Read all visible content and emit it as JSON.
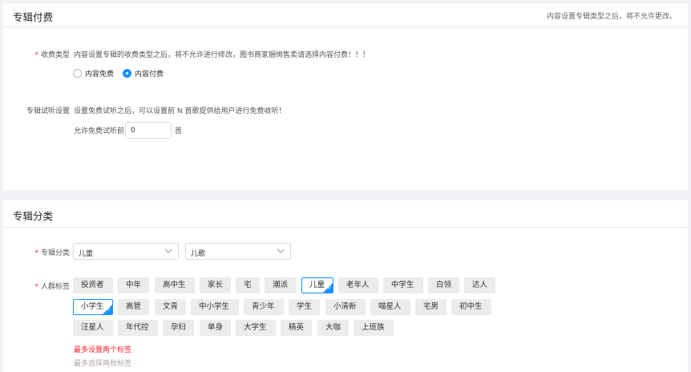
{
  "section1": {
    "title": "专辑付费",
    "note": "内容设置专辑类型之后，将不允许更改。",
    "fee_type": {
      "label": "收费类型",
      "required_mark": "*",
      "description": "内容设置专辑的收费类型之后，将不允许进行修改，图书商家捆绑售卖请选择内容付费！！！",
      "options": [
        {
          "label": "内容免费",
          "checked": false
        },
        {
          "label": "内容付费",
          "checked": true
        }
      ]
    },
    "trial": {
      "label": "专辑试听设置",
      "description": "设置免费试听之后，可以设置前 N 首歌提供给用户进行免费收听！",
      "prefix": "允许免费试听前",
      "value": "0",
      "suffix": "首"
    }
  },
  "section2": {
    "title": "专辑分类",
    "category": {
      "label": "专辑分类",
      "required_mark": "*",
      "primary": "儿童",
      "secondary": "儿歌"
    },
    "audience": {
      "label": "人群标签",
      "required_mark": "*",
      "tags_row1": [
        {
          "label": "投资者",
          "selected": false
        },
        {
          "label": "中年",
          "selected": false
        },
        {
          "label": "高中生",
          "selected": false
        },
        {
          "label": "家长",
          "selected": false
        },
        {
          "label": "宅",
          "selected": false
        },
        {
          "label": "潮派",
          "selected": false
        },
        {
          "label": "儿童",
          "selected": true
        },
        {
          "label": "老年人",
          "selected": false
        },
        {
          "label": "中学生",
          "selected": false
        },
        {
          "label": "白领",
          "selected": false
        },
        {
          "label": "达人",
          "selected": false
        }
      ],
      "tags_row2": [
        {
          "label": "小学生",
          "selected": true
        },
        {
          "label": "高管",
          "selected": false
        },
        {
          "label": "文青",
          "selected": false
        },
        {
          "label": "中小学生",
          "selected": false
        },
        {
          "label": "青少年",
          "selected": false
        },
        {
          "label": "学生",
          "selected": false
        },
        {
          "label": "小清新",
          "selected": false
        },
        {
          "label": "喵星人",
          "selected": false
        },
        {
          "label": "宅男",
          "selected": false
        },
        {
          "label": "初中生",
          "selected": false
        }
      ],
      "tags_row3": [
        {
          "label": "汪星人",
          "selected": false
        },
        {
          "label": "年代控",
          "selected": false
        },
        {
          "label": "孕妇",
          "selected": false
        },
        {
          "label": "单身",
          "selected": false
        },
        {
          "label": "大学生",
          "selected": false
        },
        {
          "label": "精英",
          "selected": false
        },
        {
          "label": "大咖",
          "selected": false
        },
        {
          "label": "上班族",
          "selected": false
        }
      ],
      "error": "最多设置两个标签",
      "hint": "最多选择两枚标签"
    }
  },
  "colors": {
    "accent": "#1890ff",
    "error": "#f5222d"
  }
}
